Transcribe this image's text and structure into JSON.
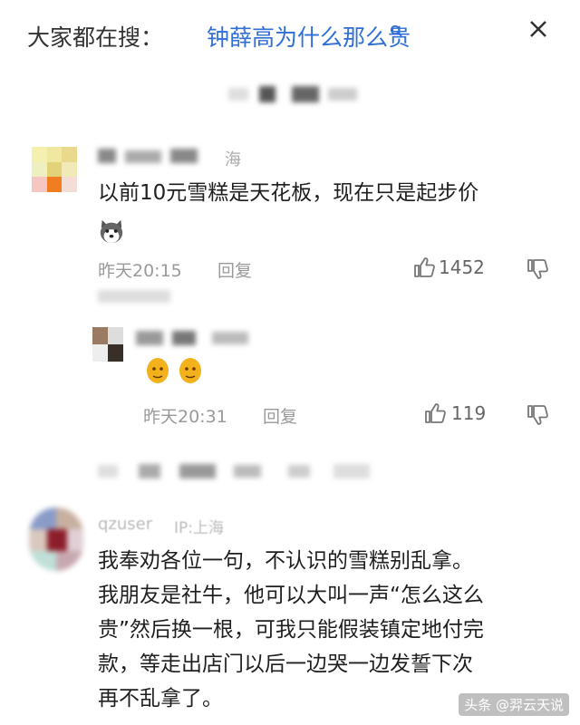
{
  "header": {
    "prefix": "大家都在搜：",
    "term": "钟薛高为什么那么贵",
    "search_icon": "search-icon",
    "close_icon": "close-icon"
  },
  "comments": [
    {
      "location_snip": "海",
      "text": "以前10元雪糕是天花板，现在只是起步价",
      "time": "昨天20:15",
      "reply_label": "回复",
      "likes": "1452"
    },
    {
      "time": "昨天20:31",
      "reply_label": "回复",
      "likes": "119"
    },
    {
      "user": "qzuser",
      "location_snip": "IP:上海",
      "text_lines": [
        "我奉劝各位一句，不认识的雪糕别乱拿。",
        "我朋友是社牛，他可以大叫一声“怎么这么",
        "贵”然后换一根，可我只能假装镇定地付完",
        "款，等走出店门以后一边哭一边发誓下次",
        "再不乱拿了。"
      ]
    }
  ],
  "watermark": "头条 @羿云天说",
  "colors": {
    "accent": "#2f6fd6",
    "muted": "#9a9a9a"
  }
}
